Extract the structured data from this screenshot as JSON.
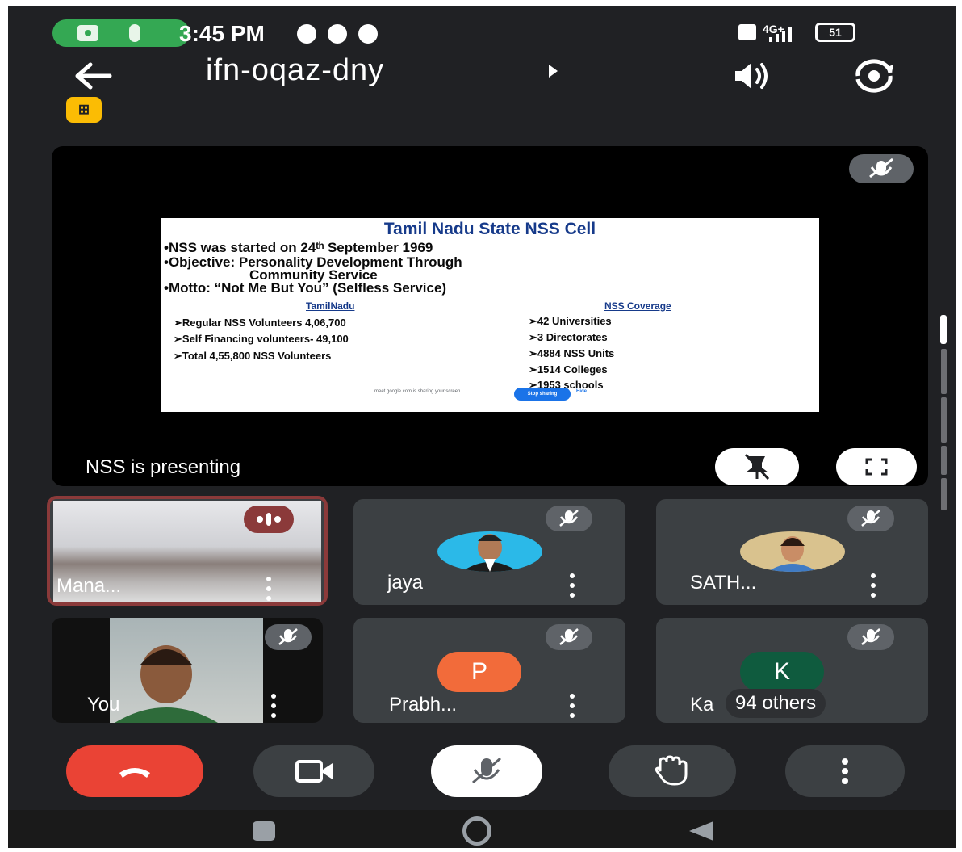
{
  "status_bar": {
    "time": "3:45 PM",
    "network": "4G+",
    "battery": "51",
    "icons": [
      "camera-in-use-icon",
      "mic-in-use-icon",
      "whatsapp-icon",
      "chat-icon",
      "phone-icon",
      "volte-icon",
      "signal-icon",
      "battery-icon"
    ]
  },
  "header": {
    "meeting_code": "ifn-oqaz-dny",
    "icons": [
      "back-arrow-icon",
      "meeting-info-caret-icon",
      "speaker-icon",
      "flip-camera-icon"
    ]
  },
  "presentation": {
    "status_label": "NSS is presenting",
    "slide": {
      "title": "Tamil Nadu  State NSS Cell",
      "lines": [
        "•NSS was started on 24ᵗʰ September 1969",
        "•Objective: Personality Development Through",
        "Community Service",
        "•Motto: “Not Me But You” (Selfless Service)"
      ],
      "left_column": {
        "heading": "TamilNadu",
        "items": [
          "➢Regular NSS Volunteers 4,06,700",
          "➢Self Financing volunteers- 49,100",
          "➢Total 4,55,800 NSS Volunteers"
        ]
      },
      "right_column": {
        "heading": "NSS Coverage",
        "items": [
          "➢42 Universities",
          "➢3 Directorates",
          "➢4884 NSS Units",
          "➢1514 Colleges",
          "➢1953 schools"
        ]
      },
      "share_notice": {
        "text": "meet.google.com is sharing your screen.",
        "stop_label": "Stop sharing",
        "hide_label": "Hide"
      }
    }
  },
  "participants": [
    {
      "name": "Mana...",
      "speaking": true
    },
    {
      "name": "jaya",
      "muted": true
    },
    {
      "name": "SATH...",
      "muted": true
    },
    {
      "name": "You",
      "muted": true
    },
    {
      "name": "Prabh...",
      "muted": true,
      "initial": "P",
      "color": "#f26b3a"
    },
    {
      "name": "Ka",
      "initial": "K",
      "color": "#0f5b3e",
      "muted": true,
      "others_label": "94 others"
    }
  ],
  "controls": [
    "end-call-button",
    "camera-toggle-button",
    "mic-toggle-button",
    "raise-hand-button",
    "more-options-button"
  ],
  "colors": {
    "background": "#202124",
    "tile": "#3c4043",
    "end_call": "#ea4335",
    "active_speaker_border": "#8b3a3a",
    "hosting_badge": "#fbbc04"
  }
}
